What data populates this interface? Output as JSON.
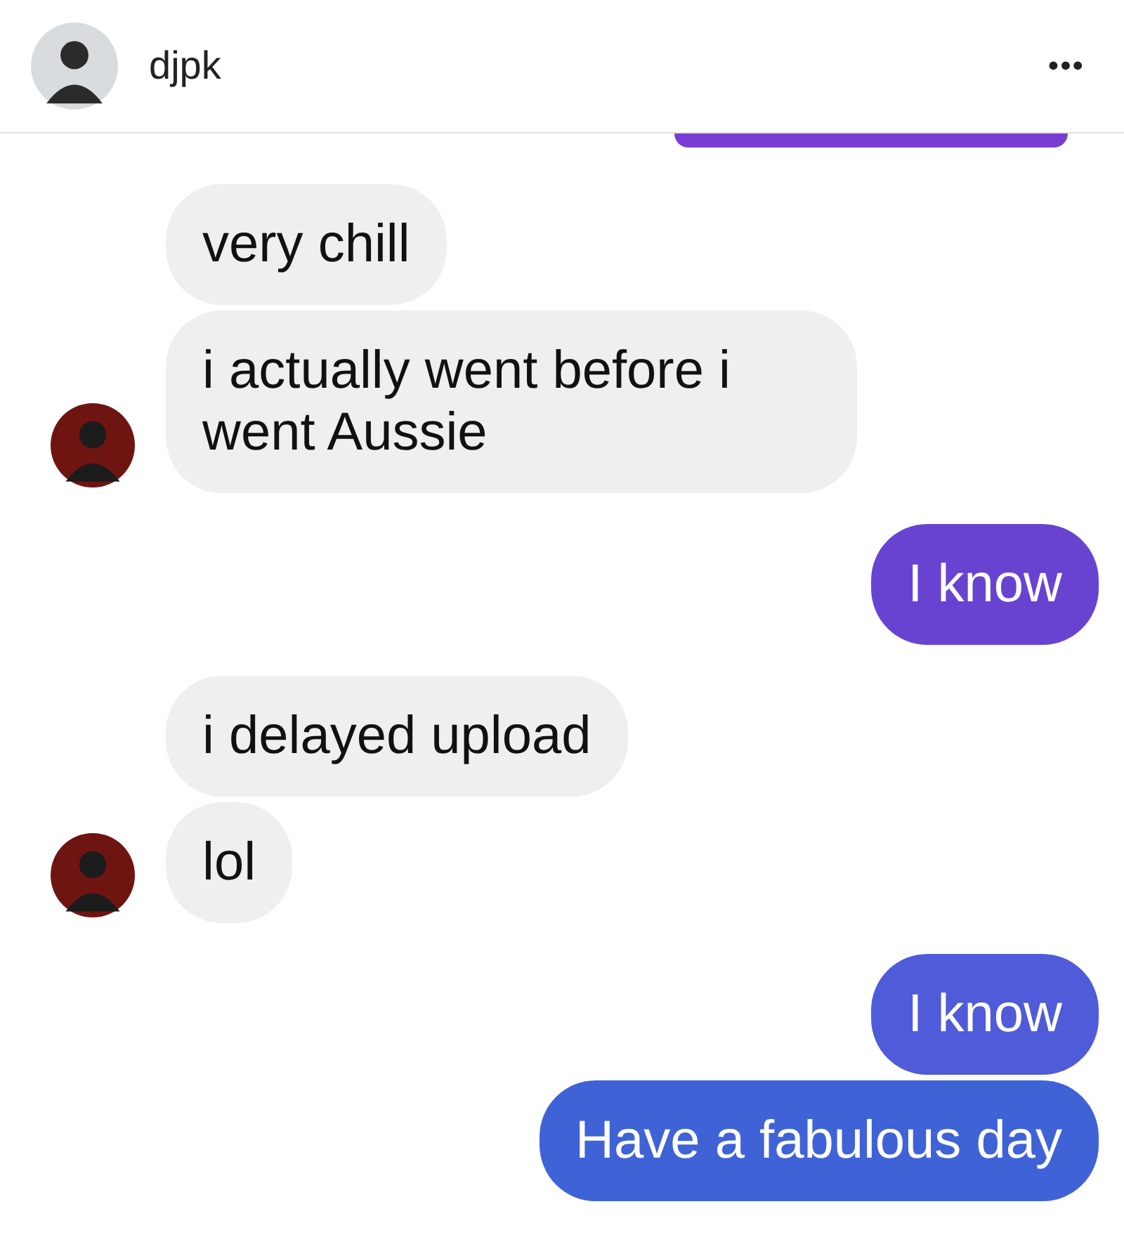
{
  "header": {
    "name": "djpk",
    "menu": "•••"
  },
  "clipped_bubble": {
    "color": "#7a3dd4"
  },
  "groups": [
    {
      "kind": "received",
      "messages": [
        {
          "text": "very chill"
        },
        {
          "text": "i actually went before i went Aussie"
        }
      ]
    },
    {
      "kind": "sent",
      "messages": [
        {
          "text": "I know",
          "color": "#6843d2"
        }
      ]
    },
    {
      "kind": "received",
      "messages": [
        {
          "text": "i delayed upload"
        },
        {
          "text": "lol"
        }
      ]
    },
    {
      "kind": "sent",
      "messages": [
        {
          "text": "I know",
          "color": "#4f5bd8"
        },
        {
          "text": "Have a fabulous day",
          "color": "#3f63d6"
        }
      ]
    }
  ]
}
